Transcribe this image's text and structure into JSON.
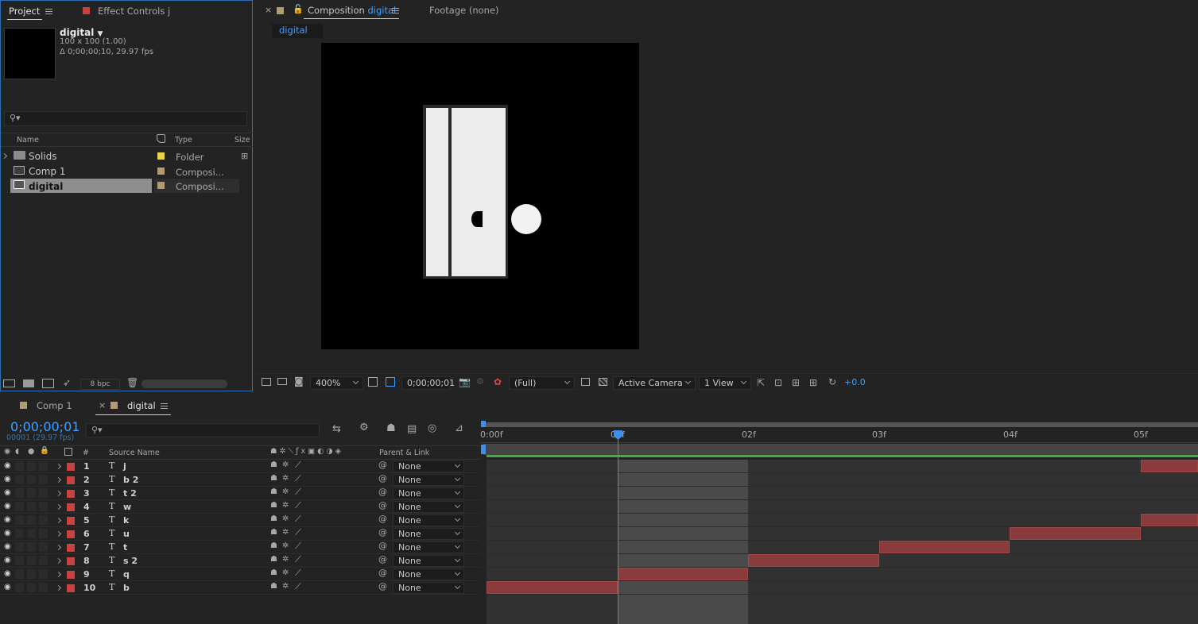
{
  "project_panel": {
    "tab_project": "Project",
    "tab_effect_controls": "Effect Controls j",
    "selected_item": {
      "name": "digital",
      "dimensions": "100 x 100  (1.00)",
      "duration": "Δ 0;00;00;10, 29.97 fps"
    },
    "search_placeholder": "",
    "columns": {
      "name": "Name",
      "type": "Type",
      "size": "Size"
    },
    "items": [
      {
        "name": "Solids",
        "type": "Folder",
        "label_color": "#e8d44d",
        "kind": "folder"
      },
      {
        "name": "Comp 1",
        "type": "Composi...",
        "label_color": "#b29a74",
        "kind": "comp"
      },
      {
        "name": "digital",
        "type": "Composi...",
        "label_color": "#b29a74",
        "kind": "comp",
        "selected": true
      }
    ],
    "bpc": "8 bpc"
  },
  "composition_panel": {
    "tab_composition_prefix": "Composition",
    "tab_composition_name": "digital",
    "tab_footage": "Footage (none)",
    "breadcrumb": "digital",
    "zoom": "400%",
    "timecode": "0;00;00;01",
    "resolution": "(Full)",
    "camera": "Active Camera",
    "views": "1 View",
    "exposure": "+0.0"
  },
  "timeline_panel": {
    "tab_comp1": "Comp 1",
    "tab_digital": "digital",
    "current_time": "0;00;00;01",
    "frame_info": "00001 (29.97 fps)",
    "search_placeholder": "",
    "col_hash": "#",
    "col_source_name": "Source Name",
    "col_parent": "Parent & Link",
    "ruler": [
      "0:00f",
      "01f",
      "02f",
      "03f",
      "04f",
      "05f"
    ],
    "layers": [
      {
        "num": "1",
        "type": "T",
        "name": "j",
        "parent": "None",
        "in_frame": 5,
        "out_frame": 6
      },
      {
        "num": "2",
        "type": "T",
        "name": "b 2",
        "parent": "None",
        "in_frame": null,
        "out_frame": null
      },
      {
        "num": "3",
        "type": "T",
        "name": "t 2",
        "parent": "None",
        "in_frame": null,
        "out_frame": null
      },
      {
        "num": "4",
        "type": "T",
        "name": "w",
        "parent": "None",
        "in_frame": null,
        "out_frame": null
      },
      {
        "num": "5",
        "type": "T",
        "name": "k",
        "parent": "None",
        "in_frame": 5,
        "out_frame": 6
      },
      {
        "num": "6",
        "type": "T",
        "name": "u",
        "parent": "None",
        "in_frame": 4,
        "out_frame": 5
      },
      {
        "num": "7",
        "type": "T",
        "name": "t",
        "parent": "None",
        "in_frame": 3,
        "out_frame": 4
      },
      {
        "num": "8",
        "type": "T",
        "name": "s 2",
        "parent": "None",
        "in_frame": 2,
        "out_frame": 3
      },
      {
        "num": "9",
        "type": "T",
        "name": "q",
        "parent": "None",
        "in_frame": 1,
        "out_frame": 2
      },
      {
        "num": "10",
        "type": "T",
        "name": "b",
        "parent": "None",
        "in_frame": 0,
        "out_frame": 1
      }
    ],
    "label_color": "#c94141",
    "playhead_frame": 1,
    "work_area_end_frame": 2
  }
}
